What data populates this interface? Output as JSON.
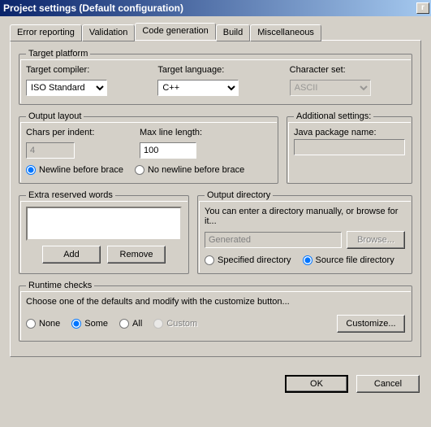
{
  "title": "Project settings (Default configuration)",
  "tabs": {
    "error_reporting": "Error reporting",
    "validation": "Validation",
    "code_generation": "Code generation",
    "build": "Build",
    "miscellaneous": "Miscellaneous",
    "active": "code_generation"
  },
  "target_platform": {
    "legend": "Target platform",
    "compiler_label": "Target compiler:",
    "compiler_value": "ISO Standard",
    "language_label": "Target language:",
    "language_value": "C++",
    "charset_label": "Character set:",
    "charset_value": "ASCII",
    "charset_disabled": true
  },
  "output_layout": {
    "legend": "Output layout",
    "chars_per_indent_label": "Chars per indent:",
    "chars_per_indent_value": "4",
    "max_line_length_label": "Max line length:",
    "max_line_length_value": "100",
    "newline_before_brace": "Newline before brace",
    "no_newline_before_brace": "No newline before brace",
    "newline_selected": "before"
  },
  "additional_settings": {
    "legend": "Additional settings:",
    "java_package_label": "Java package name:",
    "java_package_value": ""
  },
  "extra_words": {
    "legend": "Extra reserved words",
    "add": "Add",
    "remove": "Remove"
  },
  "output_directory": {
    "legend": "Output directory",
    "hint": "You can enter a directory manually, or browse for it...",
    "value": "Generated",
    "browse": "Browse...",
    "specified": "Specified directory",
    "source": "Source file directory",
    "selected": "source"
  },
  "runtime_checks": {
    "legend": "Runtime checks",
    "desc": "Choose one of the defaults and modify with the customize button...",
    "none": "None",
    "some": "Some",
    "all": "All",
    "custom": "Custom",
    "selected": "some",
    "customize": "Customize..."
  },
  "footer": {
    "ok": "OK",
    "cancel": "Cancel"
  }
}
